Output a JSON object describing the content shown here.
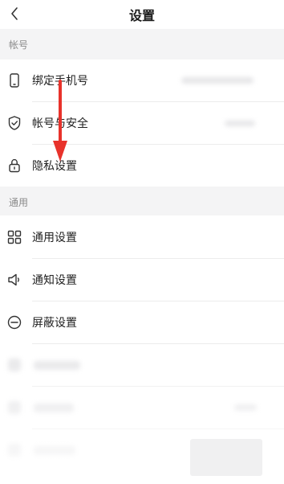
{
  "header": {
    "title": "设置",
    "back_icon": "chevron-left-icon"
  },
  "sections": {
    "account": {
      "label": "帐号",
      "items": [
        {
          "label": "绑定手机号",
          "icon": "phone-icon"
        },
        {
          "label": "帐号与安全",
          "icon": "shield-icon"
        },
        {
          "label": "隐私设置",
          "icon": "lock-icon"
        }
      ]
    },
    "general": {
      "label": "通用",
      "items": [
        {
          "label": "通用设置",
          "icon": "grid-icon"
        },
        {
          "label": "通知设置",
          "icon": "speaker-icon"
        },
        {
          "label": "屏蔽设置",
          "icon": "block-icon"
        }
      ]
    }
  },
  "annotation": {
    "arrow_color": "#e8322b"
  }
}
